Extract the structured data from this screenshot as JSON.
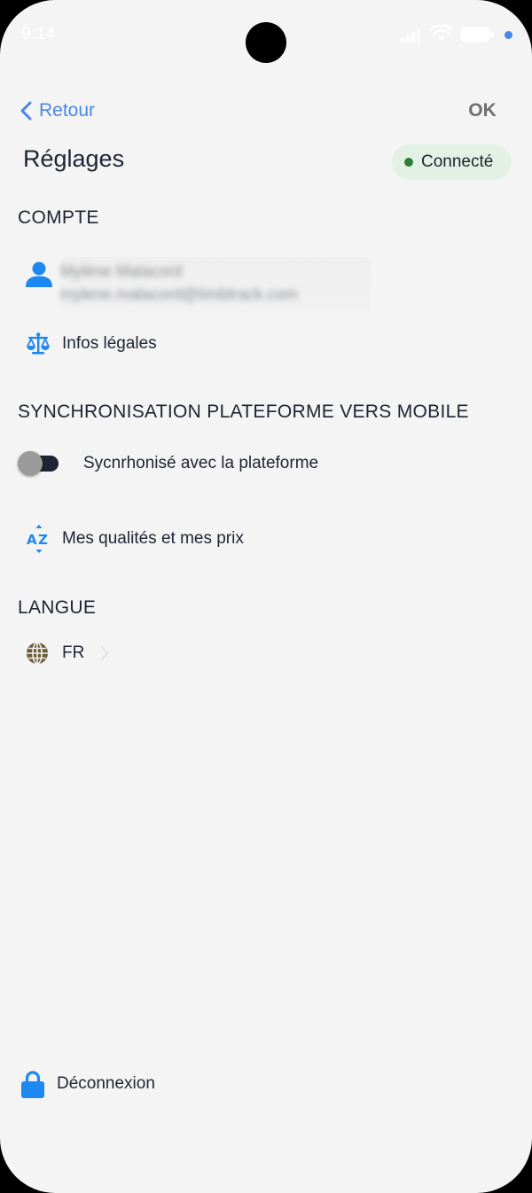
{
  "status_bar": {
    "time": "9:14",
    "icons": [
      "signal-icon",
      "wifi-icon",
      "battery-icon"
    ]
  },
  "nav": {
    "back_label": "Retour",
    "ok_label": "OK"
  },
  "header": {
    "title": "Réglages",
    "status_badge": "Connecté",
    "status_color": "#2e7d32"
  },
  "sections": {
    "account": {
      "title": "COMPTE",
      "user_name": "Mylène Malacord",
      "user_email": "mylene.malacord@timbtrack.com",
      "legal_label": "Infos légales"
    },
    "sync": {
      "title": "SYNCHRONISATION PLATEFORME VERS MOBILE",
      "toggle_label": "Sycnrhonisé avec la plateforme",
      "toggle_on": false,
      "qualities_label": "Mes qualités et mes prix"
    },
    "language": {
      "title": "LANGUE",
      "value": "FR"
    }
  },
  "footer": {
    "logout_label": "Déconnexion"
  },
  "colors": {
    "accent": "#4a86e8",
    "icon_blue": "#1e88f0",
    "text": "#1d2433",
    "background": "#f4f4f4"
  }
}
